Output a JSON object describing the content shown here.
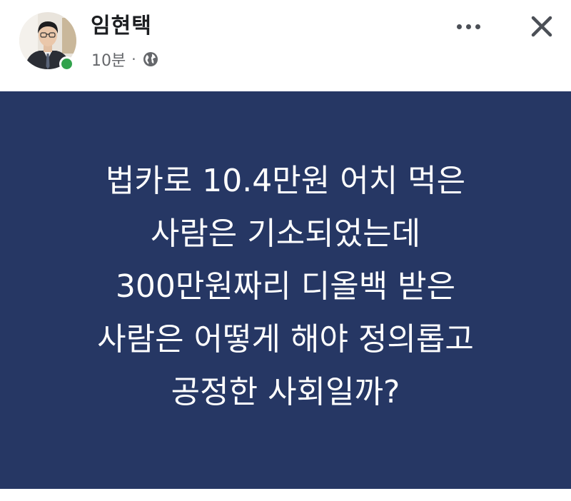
{
  "post": {
    "author": "임현택",
    "time": "10분",
    "separator": "·",
    "audience_icon": "globe-icon",
    "online_status": "online",
    "lines": [
      "법카로 10.4만원 어치 먹은",
      "사람은 기소되었는데",
      "300만원짜리 디올백 받은",
      "사람은 어떻게 해야 정의롭고",
      "공정한 사회일까?"
    ]
  },
  "icons": {
    "more": "more-horizontal-icon",
    "close": "close-icon"
  },
  "colors": {
    "post_background": "#263764",
    "online_dot": "#31a24c",
    "text_primary": "#1c1e21",
    "text_secondary": "#65676b"
  }
}
